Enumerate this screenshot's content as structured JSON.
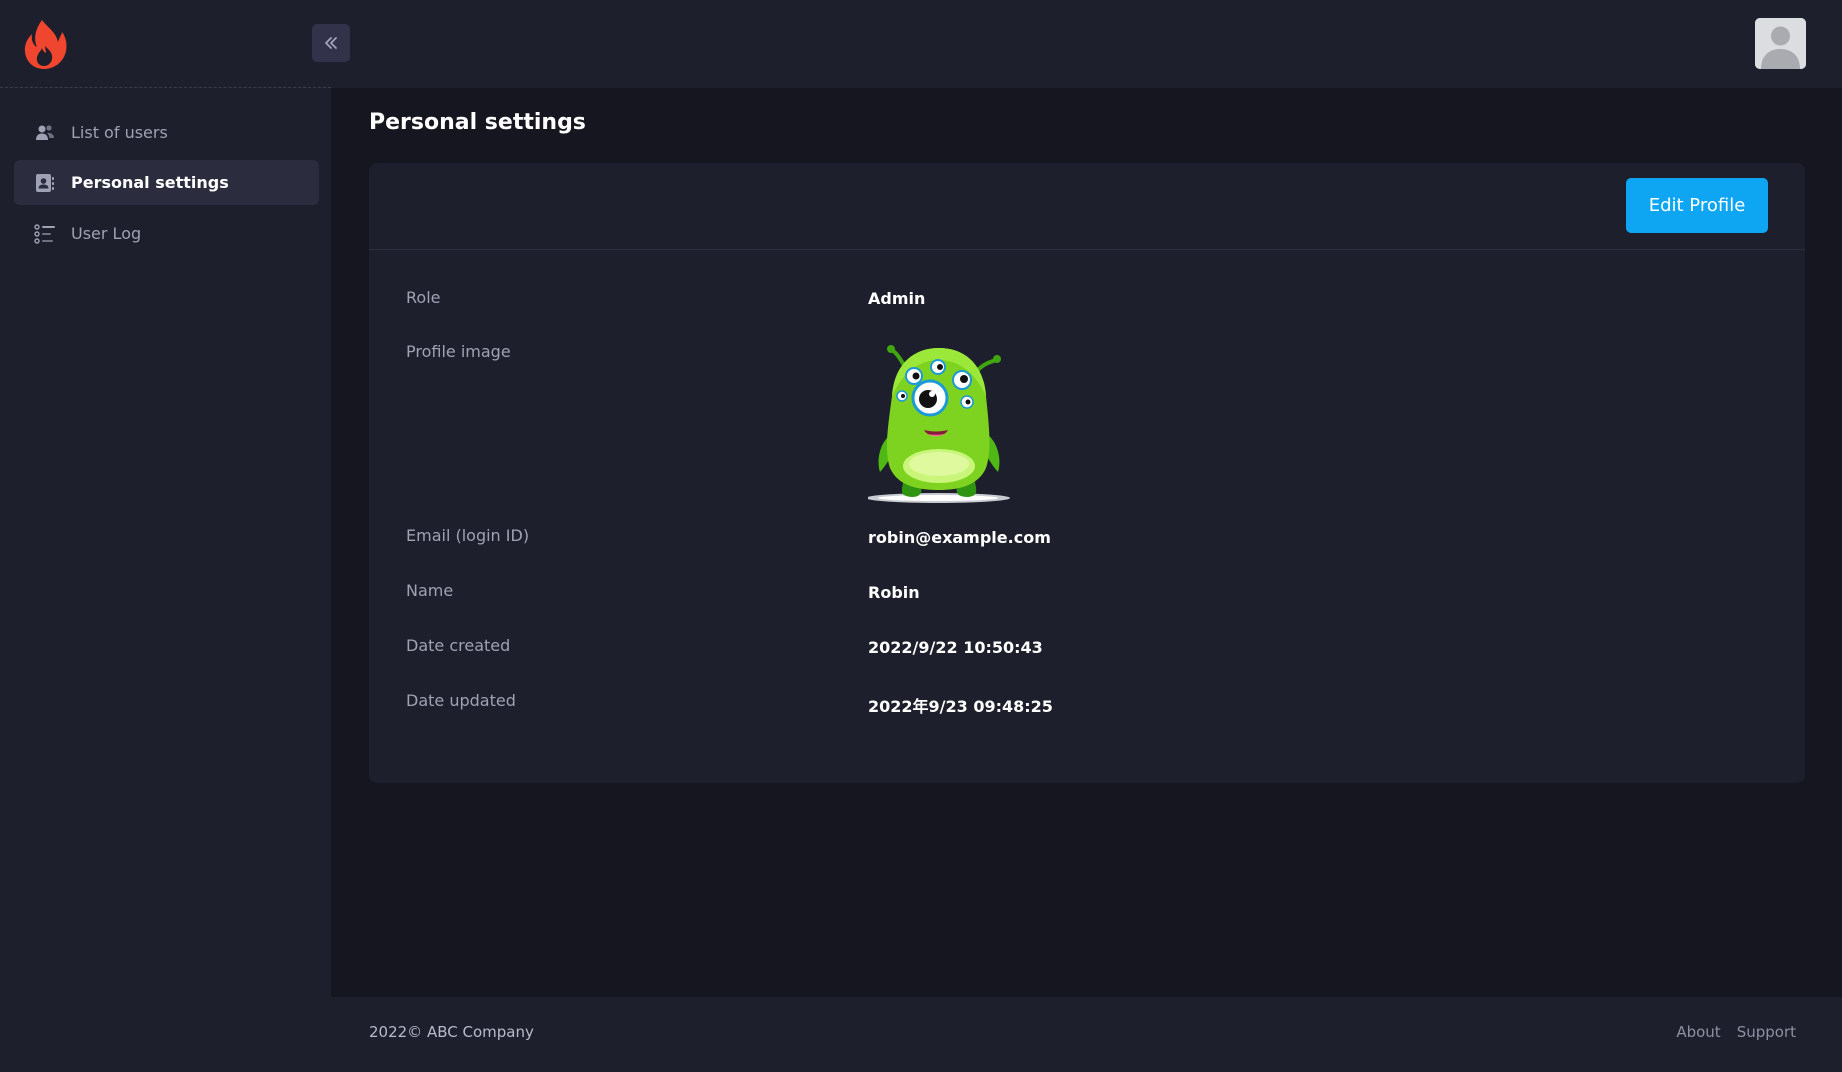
{
  "header": {
    "logo_icon": "flame-icon",
    "collapse_icon": "double-chevron-left-icon",
    "avatar_icon": "user-avatar"
  },
  "sidebar": {
    "items": [
      {
        "label": "List of users",
        "icon": "users-icon",
        "active": false
      },
      {
        "label": "Personal settings",
        "icon": "contact-card-icon",
        "active": true
      },
      {
        "label": "User Log",
        "icon": "list-icon",
        "active": false
      }
    ]
  },
  "main": {
    "title": "Personal settings",
    "edit_button": "Edit Profile",
    "fields": {
      "role": {
        "label": "Role",
        "value": "Admin"
      },
      "profile_image": {
        "label": "Profile image"
      },
      "email": {
        "label": "Email (login ID)",
        "value": "robin@example.com"
      },
      "name": {
        "label": "Name",
        "value": "Robin"
      },
      "date_created": {
        "label": "Date created",
        "value": "2022/9/22 10:50:43"
      },
      "date_updated": {
        "label": "Date updated",
        "value": "2022年9/23 09:48:25"
      }
    }
  },
  "footer": {
    "copyright": "2022©  ABC Company",
    "links": [
      "About",
      "Support"
    ]
  },
  "colors": {
    "background": "#15161f",
    "panel": "#1e1f2c",
    "accent": "#0ea5f2",
    "logo": "#f0462f"
  }
}
